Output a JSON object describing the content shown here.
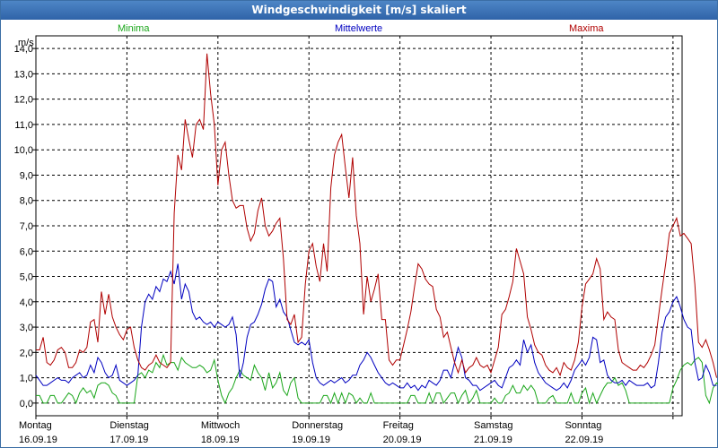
{
  "window": {
    "title": "Windgeschwindigkeit [m/s] skaliert"
  },
  "chart_data": {
    "type": "line",
    "title": "Windgeschwindigkeit [m/s] skaliert",
    "ylabel": "m/s",
    "ylim": [
      -0.5,
      14.5
    ],
    "yticks": [
      "0,0",
      "1,0",
      "2,0",
      "3,0",
      "4,0",
      "5,0",
      "6,0",
      "7,0",
      "8,0",
      "9,0",
      "10,0",
      "11,0",
      "12,0",
      "13,0",
      "14,0"
    ],
    "xlim": [
      0,
      7.1
    ],
    "xticks": [
      {
        "day": "Montag",
        "date": "16.09.19"
      },
      {
        "day": "Dienstag",
        "date": "17.09.19"
      },
      {
        "day": "Mittwoch",
        "date": "18.09.19"
      },
      {
        "day": "Donnerstag",
        "date": "19.09.19"
      },
      {
        "day": "Freitag",
        "date": "20.09.19"
      },
      {
        "day": "Samstag",
        "date": "21.09.19"
      },
      {
        "day": "Sonntag",
        "date": "22.09.19"
      }
    ],
    "grid": true,
    "legend_position": "top",
    "sample_interval_days": 0.04,
    "colors": {
      "Minima": "#1aa61a",
      "Mittelwerte": "#0000c0",
      "Maxima": "#b00000"
    },
    "series": [
      {
        "name": "Minima",
        "values": [
          0.3,
          0.3,
          0.0,
          0.0,
          0.3,
          0.3,
          0.0,
          0.0,
          0.2,
          0.4,
          0.3,
          0.0,
          0.4,
          0.6,
          0.4,
          0.5,
          0.2,
          0.7,
          0.8,
          0.8,
          0.7,
          0.4,
          0.3,
          0.0,
          0.0,
          0.0,
          0.0,
          0.0,
          1.1,
          1.2,
          1.0,
          1.3,
          1.2,
          1.6,
          1.4,
          1.9,
          1.5,
          1.6,
          1.6,
          1.3,
          1.8,
          1.6,
          1.5,
          1.4,
          1.4,
          1.5,
          1.4,
          1.2,
          1.3,
          1.7,
          0.9,
          0.3,
          0.0,
          0.4,
          0.6,
          1.0,
          1.3,
          1.1,
          1.0,
          0.9,
          1.5,
          1.2,
          1.0,
          0.5,
          1.2,
          0.6,
          0.8,
          1.2,
          0.5,
          0.3,
          0.8,
          1.0,
          0.2,
          0.0,
          0.0,
          0.0,
          0.0,
          0.0,
          0.0,
          0.3,
          0.3,
          0.0,
          0.4,
          0.0,
          0.4,
          0.0,
          0.4,
          0.3,
          0.0,
          0.2,
          0.0,
          0.0,
          0.4,
          0.0,
          0.0,
          0.0,
          0.0,
          0.0,
          0.0,
          0.0,
          0.0,
          0.0,
          0.0,
          0.3,
          0.3,
          0.0,
          0.0,
          0.0,
          0.4,
          0.0,
          0.4,
          0.4,
          0.0,
          0.2,
          0.4,
          0.4,
          0.0,
          0.3,
          0.5,
          0.0,
          0.2,
          0.5,
          0.0,
          0.0,
          0.0,
          0.0,
          0.2,
          0.0,
          0.0,
          0.3,
          0.4,
          0.7,
          0.4,
          0.4,
          0.7,
          0.5,
          0.7,
          0.5,
          0.0,
          0.0,
          0.0,
          0.2,
          0.3,
          0.0,
          0.0,
          0.0,
          0.0,
          0.4,
          0.0,
          0.0,
          0.4,
          0.6,
          0.0,
          0.4,
          0.0,
          0.3,
          0.6,
          0.8,
          0.8,
          1.0,
          0.7,
          0.8,
          0.5,
          0.0,
          0.0,
          0.0,
          0.0,
          0.0,
          0.0,
          0.0,
          0.0,
          0.0,
          0.0,
          0.0,
          0.0,
          0.6,
          0.9,
          1.3,
          1.5,
          1.6,
          1.5,
          1.7,
          1.8,
          1.6,
          0.3,
          0.0,
          0.6,
          0.8,
          0.7,
          0.0,
          0.0
        ]
      },
      {
        "name": "Mittelwerte",
        "values": [
          1.1,
          0.9,
          0.7,
          0.7,
          0.8,
          0.9,
          1.0,
          0.9,
          0.9,
          0.8,
          1.0,
          1.1,
          1.2,
          1.0,
          1.1,
          1.5,
          1.2,
          1.8,
          1.6,
          1.2,
          1.0,
          1.1,
          1.5,
          0.9,
          0.8,
          0.7,
          0.8,
          0.9,
          1.1,
          3.0,
          4.0,
          4.3,
          4.1,
          4.6,
          4.4,
          4.9,
          4.8,
          5.2,
          4.7,
          5.5,
          4.1,
          4.7,
          4.4,
          3.6,
          3.3,
          3.4,
          3.2,
          3.1,
          3.2,
          3.0,
          3.2,
          3.1,
          3.0,
          3.1,
          3.4,
          2.7,
          1.0,
          1.6,
          2.6,
          3.1,
          3.2,
          3.5,
          3.9,
          4.5,
          4.9,
          4.8,
          3.8,
          4.1,
          3.6,
          3.4,
          2.9,
          2.4,
          2.3,
          2.4,
          2.3,
          2.5,
          1.6,
          1.0,
          0.8,
          0.7,
          0.8,
          0.9,
          0.8,
          0.9,
          1.0,
          0.8,
          0.9,
          1.1,
          1.1,
          1.5,
          1.7,
          2.0,
          1.8,
          1.5,
          1.2,
          1.0,
          0.8,
          0.7,
          0.8,
          0.7,
          0.6,
          0.6,
          0.8,
          0.6,
          0.7,
          0.5,
          0.7,
          0.6,
          0.9,
          0.8,
          0.7,
          0.9,
          1.3,
          1.3,
          1.0,
          1.6,
          2.2,
          1.8,
          1.0,
          0.9,
          0.7,
          0.7,
          0.5,
          0.6,
          0.7,
          0.8,
          0.9,
          0.7,
          0.6,
          1.0,
          1.4,
          1.5,
          1.7,
          1.5,
          2.5,
          2.0,
          2.3,
          1.6,
          1.2,
          1.0,
          0.8,
          0.7,
          0.6,
          0.5,
          0.6,
          0.8,
          0.6,
          0.9,
          1.3,
          1.5,
          1.7,
          1.5,
          1.8,
          2.6,
          2.5,
          1.6,
          1.7,
          1.1,
          0.9,
          0.8,
          0.8,
          0.9,
          0.7,
          0.9,
          0.8,
          0.7,
          0.7,
          0.7,
          0.8,
          0.6,
          0.7,
          1.6,
          2.8,
          3.4,
          3.6,
          4.0,
          4.2,
          3.8,
          3.3,
          3.0,
          2.9,
          1.6,
          0.9,
          1.0,
          1.5,
          1.2,
          0.7,
          0.7
        ]
      },
      {
        "name": "Maxima",
        "values": [
          2.1,
          2.1,
          2.6,
          1.6,
          1.5,
          1.7,
          2.1,
          2.2,
          2.0,
          1.4,
          1.4,
          1.6,
          2.1,
          2.0,
          2.2,
          3.2,
          3.3,
          2.4,
          4.4,
          3.5,
          4.3,
          3.4,
          3.0,
          2.7,
          2.5,
          2.9,
          3.0,
          2.2,
          1.7,
          1.4,
          1.3,
          1.5,
          1.6,
          1.9,
          1.6,
          1.5,
          1.4,
          1.6,
          7.5,
          9.8,
          9.2,
          11.2,
          10.4,
          9.7,
          11.0,
          11.2,
          10.8,
          13.8,
          12.2,
          11.0,
          8.6,
          10.0,
          10.3,
          9.0,
          8.0,
          7.7,
          7.8,
          7.8,
          6.9,
          6.4,
          6.7,
          7.6,
          8.1,
          7.0,
          6.6,
          6.8,
          7.1,
          7.3,
          5.7,
          3.3,
          3.1,
          3.5,
          2.4,
          2.6,
          4.7,
          6.0,
          6.3,
          5.4,
          4.8,
          6.3,
          5.2,
          8.5,
          9.8,
          10.3,
          10.6,
          9.3,
          8.1,
          9.7,
          7.4,
          6.3,
          3.5,
          5.0,
          4.0,
          4.5,
          5.1,
          3.3,
          3.3,
          1.7,
          1.5,
          1.7,
          1.7,
          2.3,
          2.9,
          3.6,
          4.6,
          5.5,
          5.3,
          4.9,
          4.7,
          4.6,
          3.7,
          3.4,
          2.6,
          2.8,
          2.2,
          1.6,
          1.2,
          1.7,
          1.2,
          1.4,
          1.5,
          1.8,
          1.5,
          1.4,
          1.5,
          1.2,
          1.7,
          2.2,
          3.5,
          3.7,
          4.2,
          4.8,
          6.1,
          5.6,
          5.1,
          3.4,
          2.9,
          2.3,
          2.0,
          1.9,
          1.5,
          1.3,
          1.2,
          1.4,
          1.1,
          1.6,
          1.4,
          1.3,
          1.7,
          2.4,
          3.8,
          4.7,
          4.9,
          5.1,
          5.7,
          5.3,
          3.3,
          3.6,
          3.4,
          3.3,
          2.1,
          1.6,
          1.5,
          1.4,
          1.3,
          1.3,
          1.5,
          1.4,
          1.6,
          1.9,
          2.3,
          3.4,
          4.5,
          5.5,
          6.7,
          7.0,
          7.3,
          6.6,
          6.7,
          6.5,
          6.3,
          4.7,
          2.4,
          2.2,
          2.5,
          2.1,
          1.6,
          1.0
        ]
      }
    ]
  }
}
